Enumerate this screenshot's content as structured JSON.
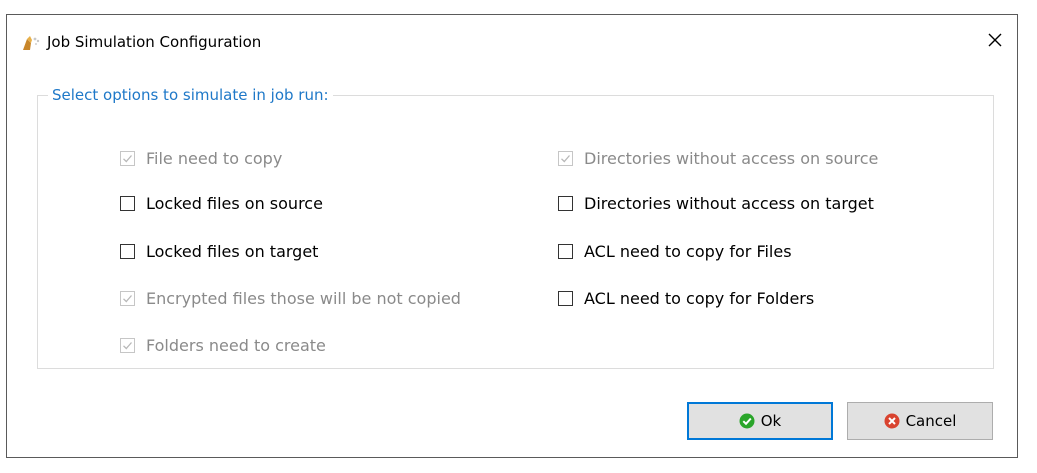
{
  "window": {
    "title": "Job Simulation Configuration"
  },
  "group": {
    "label": "Select options to simulate in job run:"
  },
  "options": [
    {
      "label": "File need to copy",
      "checked": true,
      "disabled": true
    },
    {
      "label": "Locked files on source",
      "checked": false,
      "disabled": false
    },
    {
      "label": "Locked files on target",
      "checked": false,
      "disabled": false
    },
    {
      "label": "Encrypted files those will be not copied",
      "checked": true,
      "disabled": true
    },
    {
      "label": "Folders need to create",
      "checked": true,
      "disabled": true
    },
    {
      "label": "Directories without access on source",
      "checked": true,
      "disabled": true
    },
    {
      "label": "Directories without access on target",
      "checked": false,
      "disabled": false
    },
    {
      "label": "ACL need to copy for Files",
      "checked": false,
      "disabled": false
    },
    {
      "label": "ACL need to copy for Folders",
      "checked": false,
      "disabled": false
    }
  ],
  "buttons": {
    "ok": "Ok",
    "cancel": "Cancel"
  },
  "colors": {
    "accent": "#1e78c8",
    "ok_icon": "#2aa52a",
    "cancel_icon": "#d9432f",
    "focus_border": "#0078d7"
  }
}
